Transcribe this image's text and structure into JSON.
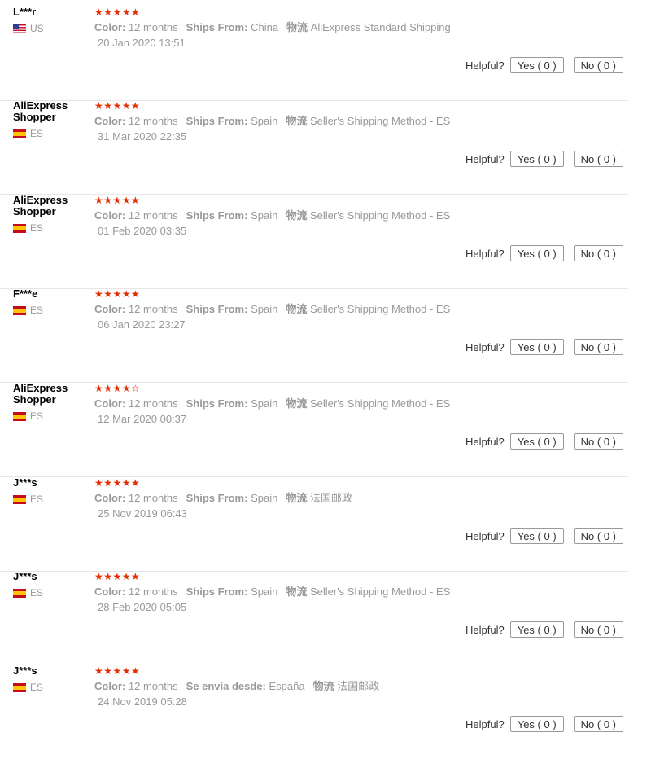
{
  "helpful_label": "Helpful?",
  "stars_full": "★★★★★",
  "stars_partial": "★★★★☆",
  "reviews": [
    {
      "name": "L***r",
      "country": "US",
      "flag": "us",
      "rating": 5,
      "color_label": "Color:",
      "color": "12 months",
      "ships_label": "Ships From:",
      "ships": "China",
      "logistics_label": "物流",
      "logistics": "AliExpress Standard Shipping",
      "date": "20 Jan 2020 13:51",
      "yes": "Yes ( 0 )",
      "no": "No ( 0 )"
    },
    {
      "name": "AliExpress Shopper",
      "country": "ES",
      "flag": "es",
      "rating": 5,
      "color_label": "Color:",
      "color": "12 months",
      "ships_label": "Ships From:",
      "ships": "Spain",
      "logistics_label": "物流",
      "logistics": "Seller's Shipping Method - ES",
      "date": "31 Mar 2020 22:35",
      "yes": "Yes ( 0 )",
      "no": "No ( 0 )"
    },
    {
      "name": "AliExpress Shopper",
      "country": "ES",
      "flag": "es",
      "rating": 5,
      "color_label": "Color:",
      "color": "12 months",
      "ships_label": "Ships From:",
      "ships": "Spain",
      "logistics_label": "物流",
      "logistics": "Seller's Shipping Method - ES",
      "date": "01 Feb 2020 03:35",
      "yes": "Yes ( 0 )",
      "no": "No ( 0 )"
    },
    {
      "name": "F***e",
      "country": "ES",
      "flag": "es",
      "rating": 5,
      "color_label": "Color:",
      "color": "12 months",
      "ships_label": "Ships From:",
      "ships": "Spain",
      "logistics_label": "物流",
      "logistics": "Seller's Shipping Method - ES",
      "date": "06 Jan 2020 23:27",
      "yes": "Yes ( 0 )",
      "no": "No ( 0 )"
    },
    {
      "name": "AliExpress Shopper",
      "country": "ES",
      "flag": "es",
      "rating": 4,
      "color_label": "Color:",
      "color": "12 months",
      "ships_label": "Ships From:",
      "ships": "Spain",
      "logistics_label": "物流",
      "logistics": "Seller's Shipping Method - ES",
      "date": "12 Mar 2020 00:37",
      "yes": "Yes ( 0 )",
      "no": "No ( 0 )"
    },
    {
      "name": "J***s",
      "country": "ES",
      "flag": "es",
      "rating": 5,
      "color_label": "Color:",
      "color": "12 months",
      "ships_label": "Ships From:",
      "ships": "Spain",
      "logistics_label": "物流",
      "logistics": "法国邮政",
      "date": "25 Nov 2019 06:43",
      "yes": "Yes ( 0 )",
      "no": "No ( 0 )"
    },
    {
      "name": "J***s",
      "country": "ES",
      "flag": "es",
      "rating": 5,
      "color_label": "Color:",
      "color": "12 months",
      "ships_label": "Ships From:",
      "ships": "Spain",
      "logistics_label": "物流",
      "logistics": "Seller's Shipping Method - ES",
      "date": "28 Feb 2020 05:05",
      "yes": "Yes ( 0 )",
      "no": "No ( 0 )"
    },
    {
      "name": "J***s",
      "country": "ES",
      "flag": "es",
      "rating": 5,
      "color_label": "Color:",
      "color": "12 months",
      "ships_label": "Se envía desde:",
      "ships": "España",
      "logistics_label": "物流",
      "logistics": "法国邮政",
      "date": "24 Nov 2019 05:28",
      "yes": "Yes ( 0 )",
      "no": "No ( 0 )"
    }
  ]
}
